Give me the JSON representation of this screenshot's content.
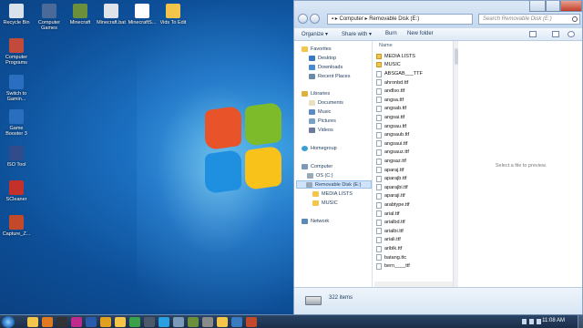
{
  "desktop": {
    "icons": [
      {
        "label": "Recycle Bin",
        "icon": "recycle-bin-icon",
        "color": "#d9e2ea"
      },
      {
        "label": "Computer Games",
        "icon": "games-icon",
        "color": "#4a6a9a"
      },
      {
        "label": "Minecraft",
        "icon": "minecraft-icon",
        "color": "#6b8f3a"
      },
      {
        "label": "Minecraft.bat",
        "icon": "batch-file-icon",
        "color": "#e0e4ea"
      },
      {
        "label": "MinecraftS...",
        "icon": "document-icon",
        "color": "#ffffff"
      },
      {
        "label": "Vids To Edit",
        "icon": "folder-icon",
        "color": "#f3c54a"
      },
      {
        "label": "Computer Programs",
        "icon": "folder-icon",
        "color": "#c24a3a"
      },
      {
        "label": "Switch to Gamin...",
        "icon": "gaming-icon",
        "color": "#2a6ec0"
      },
      {
        "label": "Game Booster 3",
        "icon": "game-booster-icon",
        "color": "#2a6ec0"
      },
      {
        "label": "ISO Tool",
        "icon": "iso-tool-icon",
        "color": "#304c8a"
      },
      {
        "label": "SCleaner",
        "icon": "cleaner-icon",
        "color": "#c4302a"
      },
      {
        "label": "Capture_Z...",
        "icon": "capture-icon",
        "color": "#c24a2a"
      }
    ]
  },
  "explorer": {
    "address": [
      "Computer",
      "Removable Disk (E:)"
    ],
    "search_placeholder": "Search Removable Disk (E:)",
    "toolbar": {
      "organize": "Organize ▾",
      "share": "Share with ▾",
      "burn": "Burn",
      "new_folder": "New folder"
    },
    "nav": {
      "favorites": "Favorites",
      "desktop": "Desktop",
      "downloads": "Downloads",
      "recent": "Recent Places",
      "libraries": "Libraries",
      "documents": "Documents",
      "music": "Music",
      "pictures": "Pictures",
      "videos": "Videos",
      "homegroup": "Homegroup",
      "computer": "Computer",
      "os": "OS (C:)",
      "removable": "Removable Disk (E:)",
      "media_lists": "MEDIA LISTS",
      "music_folder": "MUSIC",
      "network": "Network"
    },
    "column_name": "Name",
    "files": [
      {
        "name": "MEDIA LISTS",
        "type": "folder"
      },
      {
        "name": "MUSIC",
        "type": "folder"
      },
      {
        "name": "ABSGAB___TTF",
        "type": "font"
      },
      {
        "name": "ahronbd.ttf",
        "type": "font"
      },
      {
        "name": "andlso.ttf",
        "type": "font"
      },
      {
        "name": "angsa.ttf",
        "type": "font"
      },
      {
        "name": "angsab.ttf",
        "type": "font"
      },
      {
        "name": "angsai.ttf",
        "type": "font"
      },
      {
        "name": "angsau.ttf",
        "type": "font"
      },
      {
        "name": "angsaub.ttf",
        "type": "font"
      },
      {
        "name": "angsaui.ttf",
        "type": "font"
      },
      {
        "name": "angsauz.ttf",
        "type": "font"
      },
      {
        "name": "angsaz.ttf",
        "type": "font"
      },
      {
        "name": "aparaj.ttf",
        "type": "font"
      },
      {
        "name": "aparajb.ttf",
        "type": "font"
      },
      {
        "name": "aparajbi.ttf",
        "type": "font"
      },
      {
        "name": "aparaji.ttf",
        "type": "font"
      },
      {
        "name": "arabtype.ttf",
        "type": "font"
      },
      {
        "name": "arial.ttf",
        "type": "font"
      },
      {
        "name": "arialbd.ttf",
        "type": "font"
      },
      {
        "name": "arialbi.ttf",
        "type": "font"
      },
      {
        "name": "ariali.ttf",
        "type": "font"
      },
      {
        "name": "ariblk.ttf",
        "type": "font"
      },
      {
        "name": "batang.ttc",
        "type": "font"
      },
      {
        "name": "bern____ttf",
        "type": "font"
      }
    ],
    "preview_text": "Select a file to preview.",
    "item_count": "322 items"
  },
  "taskbar": {
    "clock": "11:08 AM",
    "items": [
      {
        "icon": "explorer-icon",
        "color": "#f3c54a"
      },
      {
        "icon": "media-player-icon",
        "color": "#e07a20"
      },
      {
        "icon": "cmd-icon",
        "color": "#333333"
      },
      {
        "icon": "adobe-icon",
        "color": "#c02a8a"
      },
      {
        "icon": "word-icon",
        "color": "#2a5aaa"
      },
      {
        "icon": "browser-icon",
        "color": "#e0a020"
      },
      {
        "icon": "folder-icon",
        "color": "#f3c54a"
      },
      {
        "icon": "chrome-icon",
        "color": "#3aa04a"
      },
      {
        "icon": "steam-icon",
        "color": "#4a5a6a"
      },
      {
        "icon": "skype-icon",
        "color": "#2aa0e0"
      },
      {
        "icon": "network-icon",
        "color": "#7a9aba"
      },
      {
        "icon": "minecraft-icon",
        "color": "#6b8f3a"
      },
      {
        "icon": "settings-icon",
        "color": "#8a8a8a"
      },
      {
        "icon": "explorer-icon",
        "color": "#f3c54a"
      },
      {
        "icon": "app-icon",
        "color": "#3a7ac0"
      },
      {
        "icon": "video-icon",
        "color": "#c04a2a"
      }
    ]
  }
}
